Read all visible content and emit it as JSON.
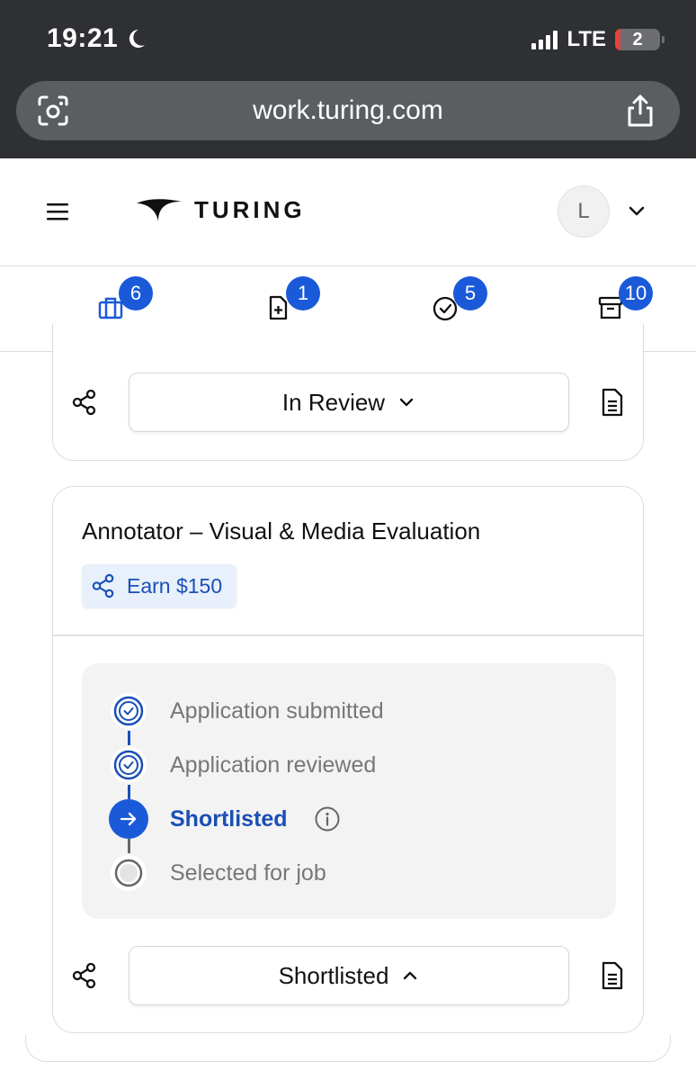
{
  "status_bar": {
    "time": "19:21",
    "network": "LTE",
    "battery": "2"
  },
  "browser": {
    "url": "work.turing.com"
  },
  "header": {
    "logo_text": "TURING",
    "avatar_initial": "L"
  },
  "tabs": [
    {
      "icon": "briefcase-icon",
      "badge": "6"
    },
    {
      "icon": "file-add-icon",
      "badge": "1"
    },
    {
      "icon": "check-circle-icon",
      "badge": "5"
    },
    {
      "icon": "archive-icon",
      "badge": "10"
    }
  ],
  "previous_card": {
    "status_label": "In Review"
  },
  "job_card": {
    "title": "Annotator – Visual & Media Evaluation",
    "referral_label": "Earn $150",
    "steps": [
      {
        "label": "Application submitted",
        "state": "done"
      },
      {
        "label": "Application reviewed",
        "state": "done"
      },
      {
        "label": "Shortlisted",
        "state": "current"
      },
      {
        "label": "Selected for job",
        "state": "pending"
      }
    ],
    "status_label": "Shortlisted"
  },
  "colors": {
    "accent": "#1a5ad8",
    "accent_text": "#1a4fb5",
    "chrome_bg": "#2e3033"
  }
}
